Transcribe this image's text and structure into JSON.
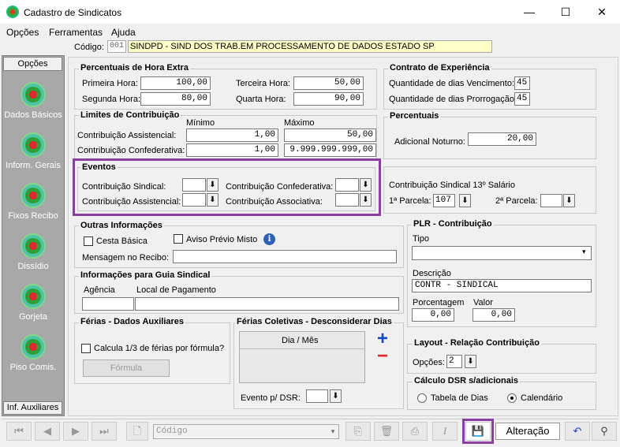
{
  "window": {
    "title": "Cadastro de Sindicatos",
    "min": "—",
    "max": "☐",
    "close": "✕"
  },
  "menu": [
    "Opções",
    "Ferramentas",
    "Ajuda"
  ],
  "codigo": {
    "label": "Código:",
    "value": "001",
    "name": "SINDPD - SIND DOS TRAB.EM PROCESSAMENTO DE DADOS ESTADO SP"
  },
  "sidebar": {
    "tab_top": "Opções",
    "tab_bottom": "Inf. Auxiliares",
    "items": [
      {
        "label": "Dados Básicos"
      },
      {
        "label": "Inform. Gerais"
      },
      {
        "label": "Fixos Recibo"
      },
      {
        "label": "Dissídio"
      },
      {
        "label": "Gorjeta"
      },
      {
        "label": "Piso Comis."
      }
    ]
  },
  "hora_extra": {
    "title": "Percentuais de Hora Extra",
    "primeira_label": "Primeira Hora:",
    "primeira": "100,00",
    "segunda_label": "Segunda Hora:",
    "segunda": "80,00",
    "terceira_label": "Terceira Hora:",
    "terceira": "50,00",
    "quarta_label": "Quarta Hora:",
    "quarta": "90,00"
  },
  "contrato": {
    "title": "Contrato de Experiência",
    "venc_label": "Quantidade de dias Vencimento:",
    "venc": "45",
    "prorr_label": "Quantidade de dias Prorrogação:",
    "prorr": "45"
  },
  "limites": {
    "title": "Limites de Contribuição",
    "min_label": "Mínimo",
    "max_label": "Máximo",
    "assist_label": "Contribuição Assistencial:",
    "assist_min": "1,00",
    "assist_max": "50,00",
    "confed_label": "Contribuição Confederativa:",
    "confed_min": "1,00",
    "confed_max": "9.999.999.999,00"
  },
  "percentuais": {
    "title": "Percentuais",
    "noturno_label": "Adicional Noturno:",
    "noturno": "20,00"
  },
  "eventos": {
    "title": "Eventos",
    "sindical": "Contribuição Sindical:",
    "assistencial": "Contribuição Assistencial:",
    "confederativa": "Contribuição Confederativa:",
    "associativa": "Contribuição Associativa:"
  },
  "sindical13": {
    "title": "Contribuição Sindical 13º Salário",
    "p1_label": "1ª Parcela:",
    "p1": "107",
    "p2_label": "2ª Parcela:"
  },
  "outras": {
    "title": "Outras Informações",
    "cesta": "Cesta Básica",
    "aviso": "Aviso Prévio Misto",
    "msg_label": "Mensagem no Recibo:"
  },
  "plr": {
    "title": "PLR - Contribuição",
    "tipo_label": "Tipo",
    "desc_label": "Descrição",
    "desc": "CONTR - SINDICAL",
    "porc_label": "Porcentagem",
    "porc": "0,00",
    "valor_label": "Valor",
    "valor": "0,00"
  },
  "guia": {
    "title": "Informações para Guia Sindical",
    "agencia_label": "Agência",
    "local_label": "Local de Pagamento"
  },
  "ferias": {
    "title": "Férias - Dados Auxiliares",
    "calc_label": "Calcula 1/3 de férias por fórmula?",
    "formula_btn": "Fórmula"
  },
  "coletivas": {
    "title": "Férias Coletivas - Desconsiderar Dias",
    "col_header": "Dia / Mês",
    "evento_label": "Evento p/ DSR:",
    "add": "+",
    "remove": "−"
  },
  "layout": {
    "title": "Layout - Relação Contribuição",
    "opcoes_label": "Opções:",
    "opcoes": "2"
  },
  "dsr": {
    "title": "Cálculo DSR s/adicionais",
    "tabela": "Tabela de Dias",
    "calendario": "Calendário"
  },
  "toolbar": {
    "codigo_placeholder": "Código",
    "status": "Alteração",
    "italic": "I"
  }
}
